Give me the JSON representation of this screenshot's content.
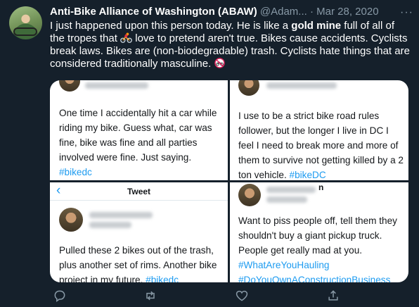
{
  "header": {
    "name": "Anti-Bike Alliance of Washington (ABAW)",
    "handle": "@Adam...",
    "separator": "·",
    "date": "Mar 28, 2020",
    "more": "···"
  },
  "tweet": {
    "part1": "I just happened upon this person today. He is like a ",
    "bold": "gold mine",
    "part2": " full of all of the tropes that ",
    "part3": " love to pretend aren't true. Bikes cause accidents. Cyclists break laws. Bikes are (non-biodegradable) trash. Cyclists hate things that are considered traditionally masculine. ",
    "emoji_cyclist": "person-biking-icon",
    "emoji_no_bikes": "no-bicycles-icon"
  },
  "media": {
    "panel1": {
      "text": "One time I accidentally hit a car while riding my bike. Guess what, car was fine, bike was fine and all parties involved were fine. Just saying.",
      "hashtag": "#bikedc"
    },
    "panel2": {
      "text": "I use to be a strict bike road rules follower, but the longer I live in DC I feel I need to break more and more of them to survive not getting killed by a 2 ton vehicle.",
      "hashtag": "#bikeDC"
    },
    "panel3": {
      "title": "Tweet",
      "back": "‹",
      "text": "Pulled these 2 bikes out of the trash, plus another set of rims. Another bike project in my future.",
      "hashtag": "#bikedc"
    },
    "panel4": {
      "name_fragment": "n",
      "text": "Want to piss people off, tell them they shouldn't buy a giant pickup truck. People get really mad at you.",
      "hashtag1": "#WhatAreYouHauling",
      "hashtag2": "#DoYouOwnAConstructionBusiness"
    }
  },
  "actions": {
    "reply": "reply-icon",
    "retweet": "retweet-icon",
    "like": "heart-icon",
    "share": "share-icon",
    "icon_color": "#8899a6"
  }
}
